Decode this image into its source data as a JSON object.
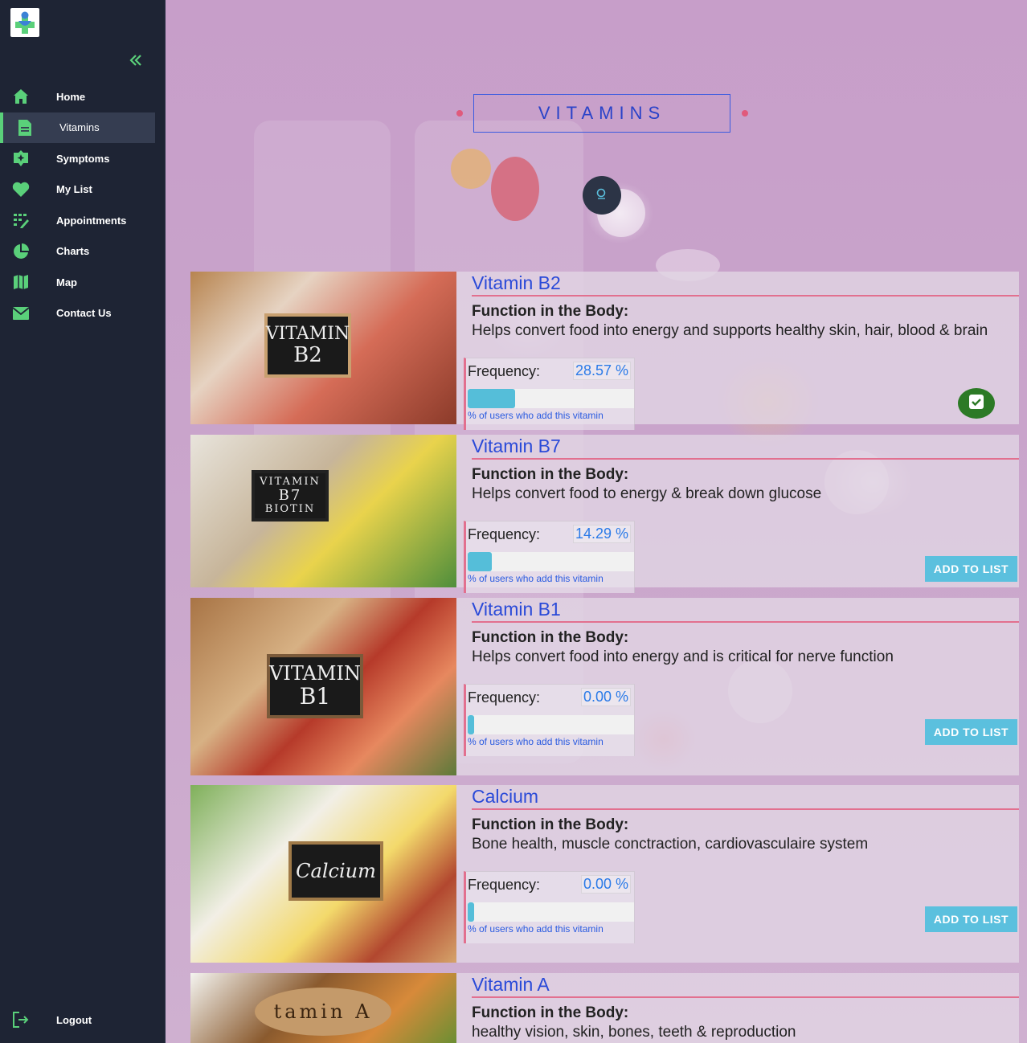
{
  "sidebar": {
    "items": [
      {
        "label": "Home",
        "icon": "home-icon"
      },
      {
        "label": "Vitamins",
        "icon": "document-icon"
      },
      {
        "label": "Symptoms",
        "icon": "symptoms-icon"
      },
      {
        "label": "My List",
        "icon": "heart-icon"
      },
      {
        "label": "Appointments",
        "icon": "calendar-grid-icon"
      },
      {
        "label": "Charts",
        "icon": "pie-chart-icon"
      },
      {
        "label": "Map",
        "icon": "map-icon"
      },
      {
        "label": "Contact Us",
        "icon": "envelope-icon"
      }
    ],
    "active": "Vitamins",
    "logout_label": "Logout"
  },
  "page": {
    "title": "VITAMINS"
  },
  "vitamins": [
    {
      "name": "Vitamin B2",
      "function_heading": "Function in the Body:",
      "function": "Helps convert food into energy and supports healthy skin, hair, blood & brain",
      "frequency_label": "Frequency:",
      "frequency_value": "28.57 %",
      "frequency_percent": 28.57,
      "caption": "% of users who add this vitamin",
      "image_text": [
        "VITAMIN",
        "B2"
      ],
      "in_list": true
    },
    {
      "name": "Vitamin B7",
      "function_heading": "Function in the Body:",
      "function": "Helps convert food to energy & break down glucose",
      "frequency_label": "Frequency:",
      "frequency_value": "14.29 %",
      "frequency_percent": 14.29,
      "caption": "% of users who add this vitamin",
      "image_text": [
        "VITAMIN",
        "B7",
        "BIOTIN"
      ],
      "button_label": "ADD TO LIST",
      "in_list": false
    },
    {
      "name": "Vitamin B1",
      "function_heading": "Function in the Body:",
      "function": "Helps convert food into energy and is critical for nerve function",
      "frequency_label": "Frequency:",
      "frequency_value": "0.00 %",
      "frequency_percent": 0,
      "caption": "% of users who add this vitamin",
      "image_text": [
        "VITAMIN",
        "B1"
      ],
      "button_label": "ADD TO LIST",
      "in_list": false
    },
    {
      "name": "Calcium",
      "function_heading": "Function in the Body:",
      "function": "Bone health, muscle conctraction, cardiovasculaire system",
      "frequency_label": "Frequency:",
      "frequency_value": "0.00 %",
      "frequency_percent": 0,
      "caption": "% of users who add this vitamin",
      "image_text": [
        "Calcium"
      ],
      "button_label": "ADD TO LIST",
      "in_list": false
    },
    {
      "name": "Vitamin A",
      "function_heading": "Function in the Body:",
      "function": "healthy vision, skin, bones, teeth & reproduction",
      "image_text": [
        "tamin A"
      ]
    }
  ],
  "colors": {
    "sidebar_bg": "#1e2434",
    "accent_green": "#5ad07a",
    "title_blue": "#2a43c9",
    "pink_rule": "#e2708f",
    "add_button": "#5bc0de",
    "added_button": "#2c7a26"
  }
}
